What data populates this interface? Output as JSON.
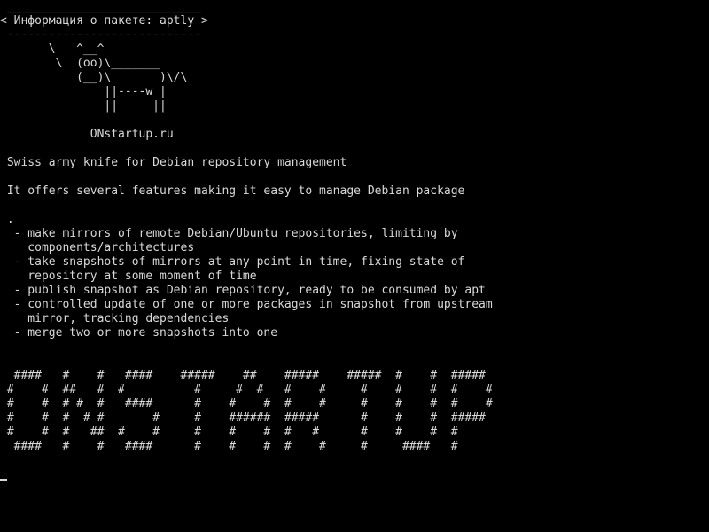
{
  "terminal": {
    "lines": [
      " ____________________________",
      "< Информация о пакете: aptly >",
      " ----------------------------",
      "       \\   ^__^",
      "        \\  (oo)\\_______",
      "           (__)\\       )\\/\\",
      "               ||----w |",
      "               ||     ||",
      "",
      "             ONstartup.ru",
      "",
      " Swiss army knife for Debian repository management",
      "",
      " It offers several features making it easy to manage Debian package",
      "",
      " .",
      "  - make mirrors of remote Debian/Ubuntu repositories, limiting by",
      "    components/architectures",
      "  - take snapshots of mirrors at any point in time, fixing state of",
      "    repository at some moment of time",
      "  - publish snapshot as Debian repository, ready to be consumed by apt",
      "  - controlled update of one or more packages in snapshot from upstream",
      "    mirror, tracking dependencies",
      "  - merge two or more snapshots into one",
      "",
      "",
      "  ####   #    #   ####    #####    ##    #####    #####  #    #  #####",
      " #    #  ##   #  #          #     #  #   #    #     #    #    #  #    #",
      " #    #  # #  #   ####      #    #    #  #    #     #    #    #  #    #",
      " #    #  #  # #       #     #    ######  #####      #    #    #  #####",
      " #    #  #   ##  #    #     #    #    #  #   #      #    #    #  #",
      "  ####   #    #   ####      #    #    #  #    #     #     ####   #"
    ],
    "cursor": "_"
  }
}
